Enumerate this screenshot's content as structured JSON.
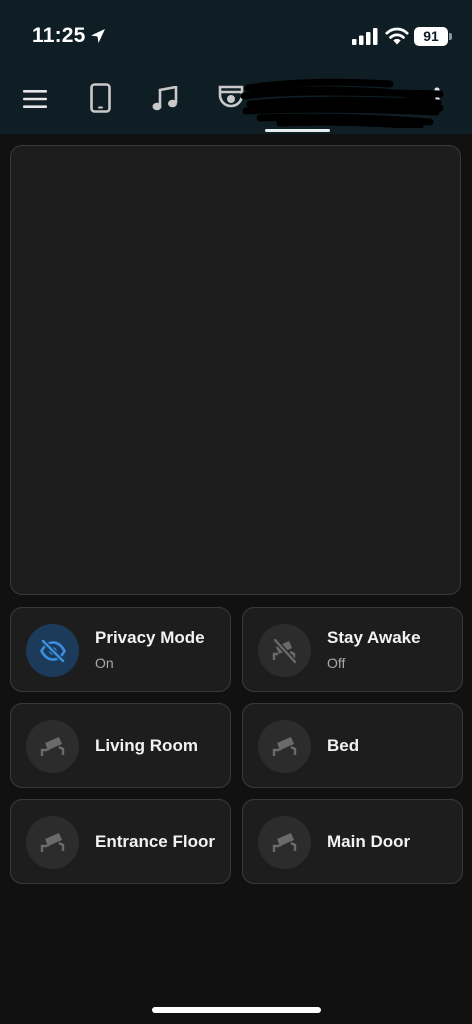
{
  "status_bar": {
    "time": "11:25",
    "battery": "91"
  },
  "toolbar": {
    "icons": [
      "menu-icon",
      "tablet-icon",
      "music-note-icon",
      "security-camera-icon",
      "more-vert-icon"
    ],
    "active_tab_index": 3
  },
  "tiles": [
    {
      "name": "Privacy Mode",
      "state": "On",
      "icon": "eye-off-icon",
      "active": true
    },
    {
      "name": "Stay Awake",
      "state": "Off",
      "icon": "cctv-off-icon",
      "active": false
    },
    {
      "name": "Living Room",
      "icon": "cctv-icon",
      "active": false
    },
    {
      "name": "Bed",
      "icon": "cctv-icon",
      "active": false
    },
    {
      "name": "Entrance Floor",
      "icon": "cctv-icon",
      "active": false
    },
    {
      "name": "Main Door",
      "icon": "cctv-icon",
      "active": false
    }
  ],
  "colors": {
    "background": "#111111",
    "header": "#0f1d24",
    "tile": "#1d1d1d",
    "accent": "#3b8fe0"
  }
}
